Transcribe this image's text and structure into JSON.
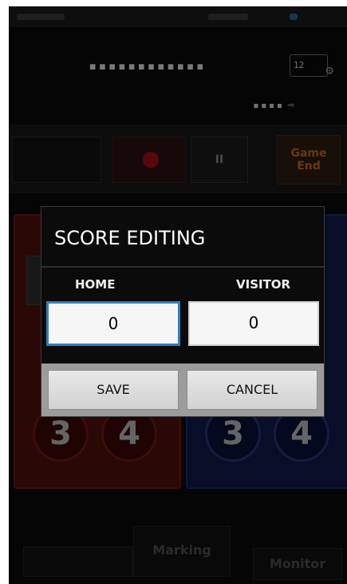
{
  "top_bar": {
    "device_id": "▪▪▪▪▪▪▪▪▪▪▪▪",
    "counter_icon": "12",
    "battery_level": "▪▪▪▪"
  },
  "controls": {
    "game_end_label": "Game End",
    "pause_label": "II"
  },
  "home_panel": {
    "buttons": [
      "3",
      "4"
    ]
  },
  "visitor_panel": {
    "buttons": [
      "3",
      "4"
    ]
  },
  "bottom_tabs": {
    "marking_label": "Marking",
    "monitor_label": "Monitor",
    "left_label": ""
  },
  "dialog": {
    "title": "SCORE EDITING",
    "home_label": "HOME",
    "visitor_label": "VISITOR",
    "home_score": "0",
    "visitor_score": "0",
    "save_label": "SAVE",
    "cancel_label": "CANCEL"
  },
  "colors": {
    "home": "#6b1a16",
    "visitor": "#1d2c6b",
    "field_focus": "#2f7fbf",
    "game_end": "#c0651f"
  },
  "icons": [
    "settings-gear-icon",
    "plug-icon",
    "record-icon",
    "pause-icon"
  ]
}
